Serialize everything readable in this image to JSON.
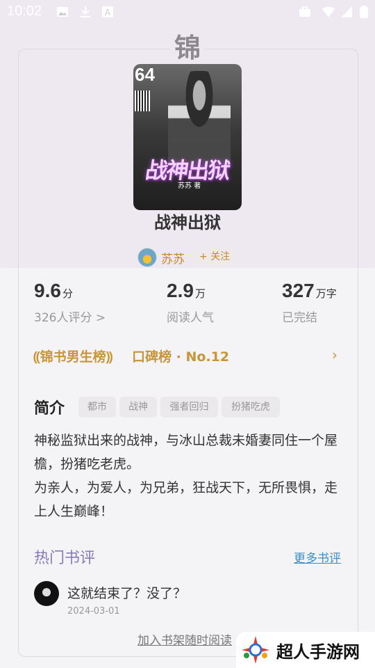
{
  "status_bar": {
    "time": "10:02"
  },
  "badge_char": "锦",
  "cover": {
    "number": "64",
    "title": "战神出狱",
    "author": "苏苏 著"
  },
  "book": {
    "title": "战神出狱"
  },
  "author": {
    "name": "苏苏",
    "follow_label": "+ 关注"
  },
  "stats": [
    {
      "value": "9.6",
      "unit": "分",
      "sub": "326人评分 >"
    },
    {
      "value": "2.9",
      "unit": "万",
      "sub": "阅读人气"
    },
    {
      "value": "327",
      "unit": "万字",
      "sub": "已完结"
    }
  ],
  "rank": {
    "list_name": "锦书男生榜",
    "text": "口碑榜 · No.12",
    "arrow": "›"
  },
  "intro": {
    "title": "简介",
    "tags": [
      "都市",
      "战神",
      "强者回归",
      "扮猪吃虎"
    ],
    "lines": [
      "神秘监狱出来的战神，与冰山总裁未婚妻同住一个屋檐，扮猪吃老虎。",
      "为亲人，为爱人，为兄弟，狂战天下，无所畏惧，走上人生巅峰！"
    ]
  },
  "reviews": {
    "title": "热门书评",
    "more_label": "更多书评",
    "items": [
      {
        "text": "这就结束了？没了？",
        "date": "2024-03-01"
      }
    ]
  },
  "add_shelf_label": "加入书架随时阅读",
  "watermark": {
    "text": "超人手游网"
  },
  "colors": {
    "accent_gold": "#c8953a",
    "reviews_title": "#8a7ab8",
    "link_blue": "#3a8ec8"
  },
  "icons": [
    "image-icon",
    "download-icon",
    "text-icon",
    "briefcase-icon",
    "wifi-icon",
    "signal-icon",
    "battery-icon",
    "chevron-right-icon",
    "laurel-icon"
  ]
}
